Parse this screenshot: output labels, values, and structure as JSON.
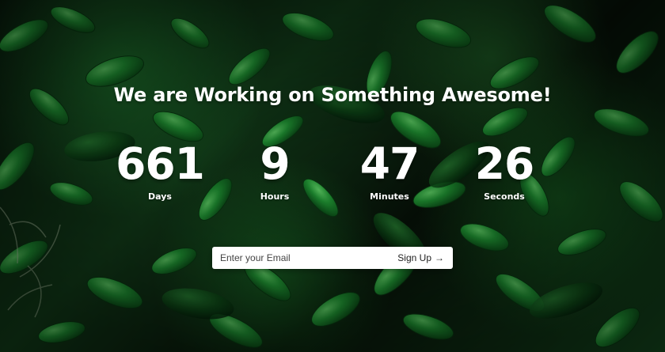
{
  "headline": "We are Working on Something Awesome!",
  "countdown": [
    {
      "value": "661",
      "label": "Days"
    },
    {
      "value": "9",
      "label": "Hours"
    },
    {
      "value": "47",
      "label": "Minutes"
    },
    {
      "value": "26",
      "label": "Seconds"
    }
  ],
  "signup": {
    "placeholder": "Enter your Email",
    "button_label": "Sign Up",
    "arrow": "→"
  },
  "colors": {
    "text": "#ffffff",
    "field_background": "#ffffff",
    "leaf_light": "#2f9b3f",
    "leaf_dark": "#0b2b11"
  },
  "icons": {
    "submit": "arrow-right-icon"
  }
}
